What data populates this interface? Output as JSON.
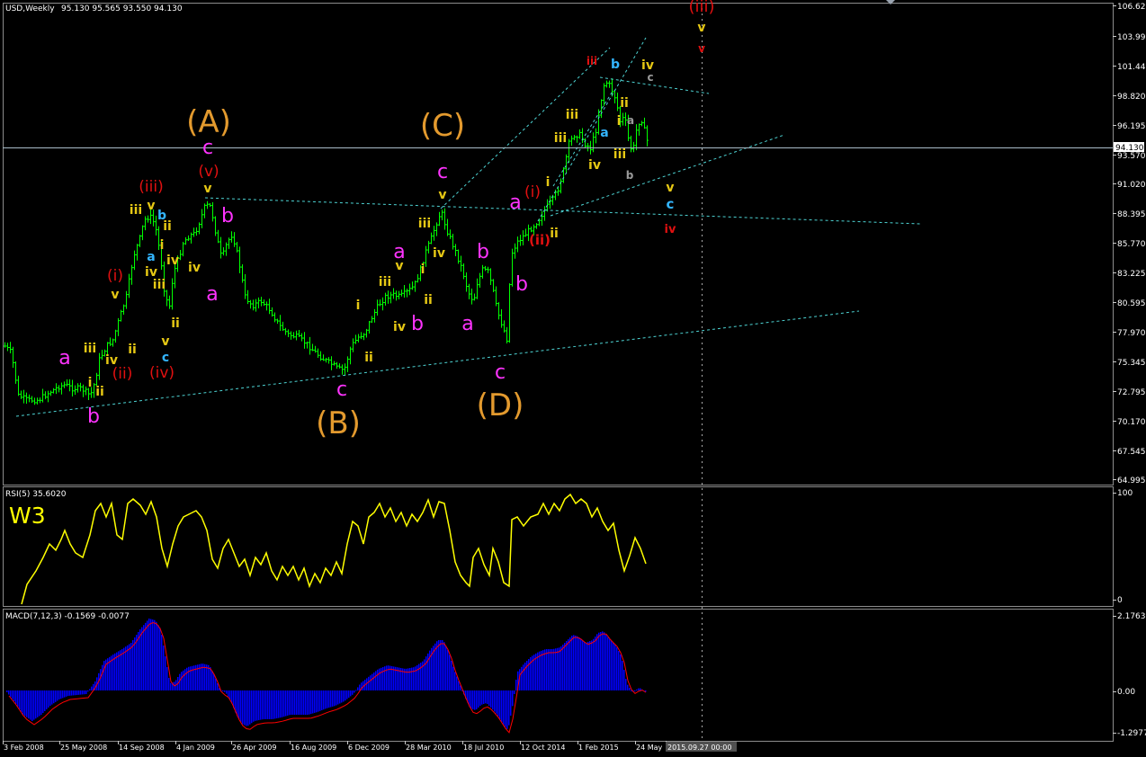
{
  "header": {
    "symbol": "USD,Weekly",
    "ohlc": "95.130 95.565 93.550 94.130"
  },
  "colors": {
    "background": "#000000",
    "frame": "#ffffff",
    "bull_candle": "#00ff00",
    "bear_candle": "#000000",
    "trendline": "#4dd3d3",
    "price_line": "#a9bdc9",
    "rsi_line": "#ffff00",
    "macd_hist": "#0000ff",
    "macd_signal": "#ff0000",
    "magenta": "#ff33ff",
    "orange": "#e39a2e",
    "red": "#e01010",
    "yellow": "#e6c814",
    "cyan": "#33b5ff"
  },
  "price_panel": {
    "current_price_tag": "94.130",
    "y_ticks": [
      "106.620",
      "103.995",
      "101.445",
      "98.820",
      "96.195",
      "93.570",
      "91.020",
      "88.395",
      "85.770",
      "83.225",
      "80.595",
      "77.970",
      "75.345",
      "72.795",
      "70.170",
      "67.545",
      "64.995"
    ]
  },
  "rsi_panel": {
    "title": "RSI(5) 35.6020",
    "watermark": "W3",
    "y_ticks": [
      "100",
      "0"
    ]
  },
  "macd_panel": {
    "title": "MACD(7,12,3) -0.1569 -0.0077",
    "y_ticks": [
      "2.1763",
      "0.00",
      "-1.2977"
    ]
  },
  "x_axis": {
    "labels": [
      "3 Feb 2008",
      "25 May 2008",
      "14 Sep 2008",
      "4 Jan 2009",
      "26 Apr 2009",
      "16 Aug 2009",
      "6 Dec 2009",
      "28 Mar 2010",
      "18 Jul 2010",
      "12 Oct 2014",
      "1 Feb 2015",
      "24 May",
      "2015.09.27 00:00"
    ]
  },
  "wave_labels": [
    {
      "t": "(A)",
      "c": "orange",
      "s": 34
    },
    {
      "t": "(B)",
      "c": "orange",
      "s": 34
    },
    {
      "t": "(C)",
      "c": "orange",
      "s": 34
    },
    {
      "t": "(D)",
      "c": "orange",
      "s": 34
    },
    {
      "t": "c",
      "c": "magenta",
      "s": 22
    },
    {
      "t": "c",
      "c": "magenta",
      "s": 22
    },
    {
      "t": "c",
      "c": "magenta",
      "s": 22
    },
    {
      "t": "c",
      "c": "magenta",
      "s": 22
    },
    {
      "t": "a",
      "c": "magenta",
      "s": 22
    },
    {
      "t": "a",
      "c": "magenta",
      "s": 22
    },
    {
      "t": "a",
      "c": "magenta",
      "s": 22
    },
    {
      "t": "a",
      "c": "magenta",
      "s": 22
    },
    {
      "t": "a",
      "c": "magenta",
      "s": 22
    },
    {
      "t": "b",
      "c": "magenta",
      "s": 22
    },
    {
      "t": "b",
      "c": "magenta",
      "s": 22
    },
    {
      "t": "b",
      "c": "magenta",
      "s": 22
    },
    {
      "t": "b",
      "c": "magenta",
      "s": 22
    },
    {
      "t": "b",
      "c": "magenta",
      "s": 22
    },
    {
      "t": "(v)",
      "c": "red",
      "s": 17
    },
    {
      "t": "(iii)",
      "c": "red",
      "s": 17
    },
    {
      "t": "(i)",
      "c": "red",
      "s": 17
    },
    {
      "t": "(ii)",
      "c": "red",
      "s": 17
    },
    {
      "t": "(iv)",
      "c": "red",
      "s": 17
    },
    {
      "t": "(i)",
      "c": "red",
      "s": 17
    },
    {
      "t": "(ii)",
      "c": "red",
      "s": 15
    },
    {
      "t": "(iii)",
      "c": "red",
      "s": 18
    },
    {
      "t": "iv",
      "c": "red",
      "s": 13
    },
    {
      "t": "v",
      "c": "yellow",
      "s": 14
    },
    {
      "t": "v",
      "c": "yellow",
      "s": 14
    },
    {
      "t": "v",
      "c": "yellow",
      "s": 14
    },
    {
      "t": "v",
      "c": "yellow",
      "s": 14
    },
    {
      "t": "v",
      "c": "yellow",
      "s": 14
    },
    {
      "t": "v",
      "c": "yellow",
      "s": 14
    },
    {
      "t": "v",
      "c": "yellow",
      "s": 14
    },
    {
      "t": "v",
      "c": "yellow",
      "s": 14
    },
    {
      "t": "iii",
      "c": "yellow",
      "s": 14
    },
    {
      "t": "iii",
      "c": "yellow",
      "s": 14
    },
    {
      "t": "iii",
      "c": "yellow",
      "s": 14
    },
    {
      "t": "iii",
      "c": "yellow",
      "s": 14
    },
    {
      "t": "iii",
      "c": "yellow",
      "s": 14
    },
    {
      "t": "iii",
      "c": "yellow",
      "s": 14
    },
    {
      "t": "iii",
      "c": "yellow",
      "s": 14
    },
    {
      "t": "iii",
      "c": "yellow",
      "s": 14
    },
    {
      "t": "iv",
      "c": "yellow",
      "s": 14
    },
    {
      "t": "iv",
      "c": "yellow",
      "s": 14
    },
    {
      "t": "iv",
      "c": "yellow",
      "s": 14
    },
    {
      "t": "iv",
      "c": "yellow",
      "s": 14
    },
    {
      "t": "iv",
      "c": "yellow",
      "s": 14
    },
    {
      "t": "iv",
      "c": "yellow",
      "s": 14
    },
    {
      "t": "iv",
      "c": "yellow",
      "s": 14
    },
    {
      "t": "iv",
      "c": "yellow",
      "s": 14
    },
    {
      "t": "ii",
      "c": "yellow",
      "s": 14
    },
    {
      "t": "ii",
      "c": "yellow",
      "s": 14
    },
    {
      "t": "ii",
      "c": "yellow",
      "s": 14
    },
    {
      "t": "ii",
      "c": "yellow",
      "s": 14
    },
    {
      "t": "ii",
      "c": "yellow",
      "s": 14
    },
    {
      "t": "ii",
      "c": "yellow",
      "s": 14
    },
    {
      "t": "ii",
      "c": "yellow",
      "s": 14
    },
    {
      "t": "ii",
      "c": "yellow",
      "s": 14
    },
    {
      "t": "i",
      "c": "yellow",
      "s": 14
    },
    {
      "t": "i",
      "c": "yellow",
      "s": 14
    },
    {
      "t": "i",
      "c": "yellow",
      "s": 14
    },
    {
      "t": "i",
      "c": "yellow",
      "s": 14
    },
    {
      "t": "i",
      "c": "yellow",
      "s": 14
    },
    {
      "t": "i",
      "c": "yellow",
      "s": 14
    },
    {
      "t": "v",
      "c": "red",
      "s": 12
    },
    {
      "t": "iii",
      "c": "red",
      "s": 12
    },
    {
      "t": "b",
      "c": "cyan",
      "s": 14
    },
    {
      "t": "a",
      "c": "cyan",
      "s": 14
    },
    {
      "t": "c",
      "c": "cyan",
      "s": 14
    },
    {
      "t": "b",
      "c": "cyan",
      "s": 14
    },
    {
      "t": "a",
      "c": "cyan",
      "s": 14
    },
    {
      "t": "c",
      "c": "cyan",
      "s": 15
    },
    {
      "t": "a",
      "c": "gray",
      "s": 12
    },
    {
      "t": "b",
      "c": "gray",
      "s": 12
    },
    {
      "t": "c",
      "c": "gray",
      "s": 12
    }
  ]
}
